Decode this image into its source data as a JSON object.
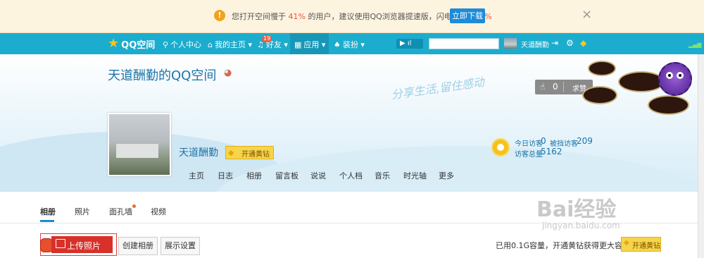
{
  "notice": {
    "text_pre": "您打开空间慢于 ",
    "pct1": "41%",
    "text_mid": " 的用户，建议使用QQ浏览器提速版，闪电提速 ",
    "pct2": "130%",
    "download_label": "立即下载",
    "close_glyph": "×",
    "warn_glyph": "!"
  },
  "nav": {
    "logo": "QQ空间",
    "items": [
      "个人中心",
      "我的主页",
      "好友",
      "应用",
      "装扮"
    ],
    "friends_badge": "19",
    "user_name": "天道酬勤"
  },
  "header": {
    "title": "天道酬勤的QQ空间",
    "slogan": "分享生活,留住感动",
    "like_count": "0",
    "like_label": "求赞"
  },
  "profile": {
    "name": "天道酬勤",
    "vip_label": "开通黄钻",
    "menu": [
      "主页",
      "日志",
      "相册",
      "留言板",
      "说说",
      "个人档",
      "音乐",
      "时光轴",
      "更多"
    ]
  },
  "visitors": {
    "today_label": "今日访客",
    "today_value": "0",
    "blocked_label": "被挡访客",
    "blocked_value": "209",
    "total_label": "访客总量",
    "total_value": "5162"
  },
  "tabs": [
    "相册",
    "照片",
    "面孔墙",
    "视频"
  ],
  "actions": {
    "upload_label": "上传照片",
    "create_album": "创建相册",
    "display_settings": "展示设置",
    "capacity_text": "已用0.1G容量，开通黄钻获得更大容量",
    "open_vip": "开通黄钻"
  },
  "watermark": {
    "line1": "Bai经验",
    "line2": "jingyan.baidu.com"
  },
  "colors": {
    "nav_bg": "#1cacce",
    "accent_blue": "#1b74a8",
    "upload_red": "#d8302a",
    "vip_yellow": "#f6d54a",
    "notice_bg": "#fdf4e0"
  },
  "icons": [
    "warning-icon",
    "close-icon",
    "qzone-star-icon",
    "person-icon",
    "home-icon",
    "bell-icon",
    "apps-grid-icon",
    "shirt-icon",
    "play-icon",
    "exit-icon",
    "gear-icon",
    "diamond-icon",
    "thumb-up-icon",
    "visitor-eye-icon",
    "image-icon"
  ]
}
